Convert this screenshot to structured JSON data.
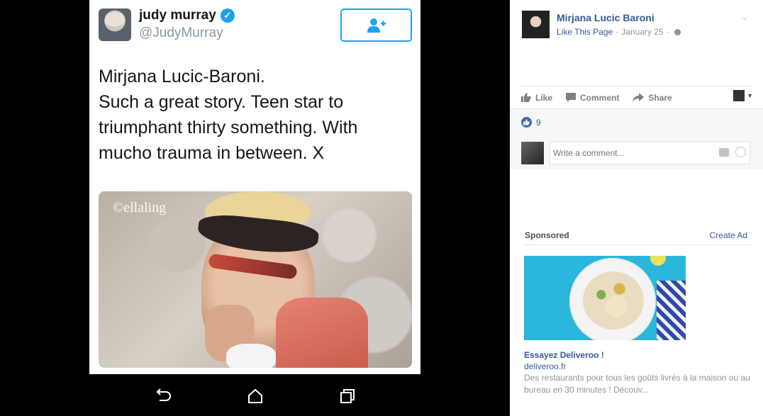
{
  "tweet": {
    "name": "judy murray",
    "handle": "@JudyMurray",
    "text_lines": [
      "Mirjana Lucic-Baroni.",
      "Such a great story. Teen star to",
      "triumphant thirty something. With",
      "mucho trauma in between. X"
    ],
    "photo_watermark": "©ellaling",
    "verified_icon": "verified-check-icon",
    "follow_icon": "add-user-icon"
  },
  "android_nav": {
    "icons": [
      "back-icon",
      "home-icon",
      "recents-icon"
    ]
  },
  "fb_post": {
    "page_name": "Mirjana Lucic Baroni",
    "like_page_label": "Like This Page",
    "separator": " · ",
    "date": "January 25",
    "separator2": " · ",
    "actions": {
      "like": "Like",
      "comment": "Comment",
      "share": "Share"
    },
    "like_count": "9",
    "comment_placeholder": "Write a comment..."
  },
  "sidebar": {
    "sponsored_label": "Sponsored",
    "create_ad_label": "Create Ad",
    "ad": {
      "title": "Essayez Deliveroo !",
      "domain": "deliveroo.fr",
      "description": "Des restaurants pour tous les goûts livrés à la maison ou au bureau en 30 minutes ! Découv..."
    }
  },
  "colors": {
    "twitter_blue": "#1da1f2",
    "facebook_link": "#365899",
    "facebook_grey": "#90949c"
  }
}
